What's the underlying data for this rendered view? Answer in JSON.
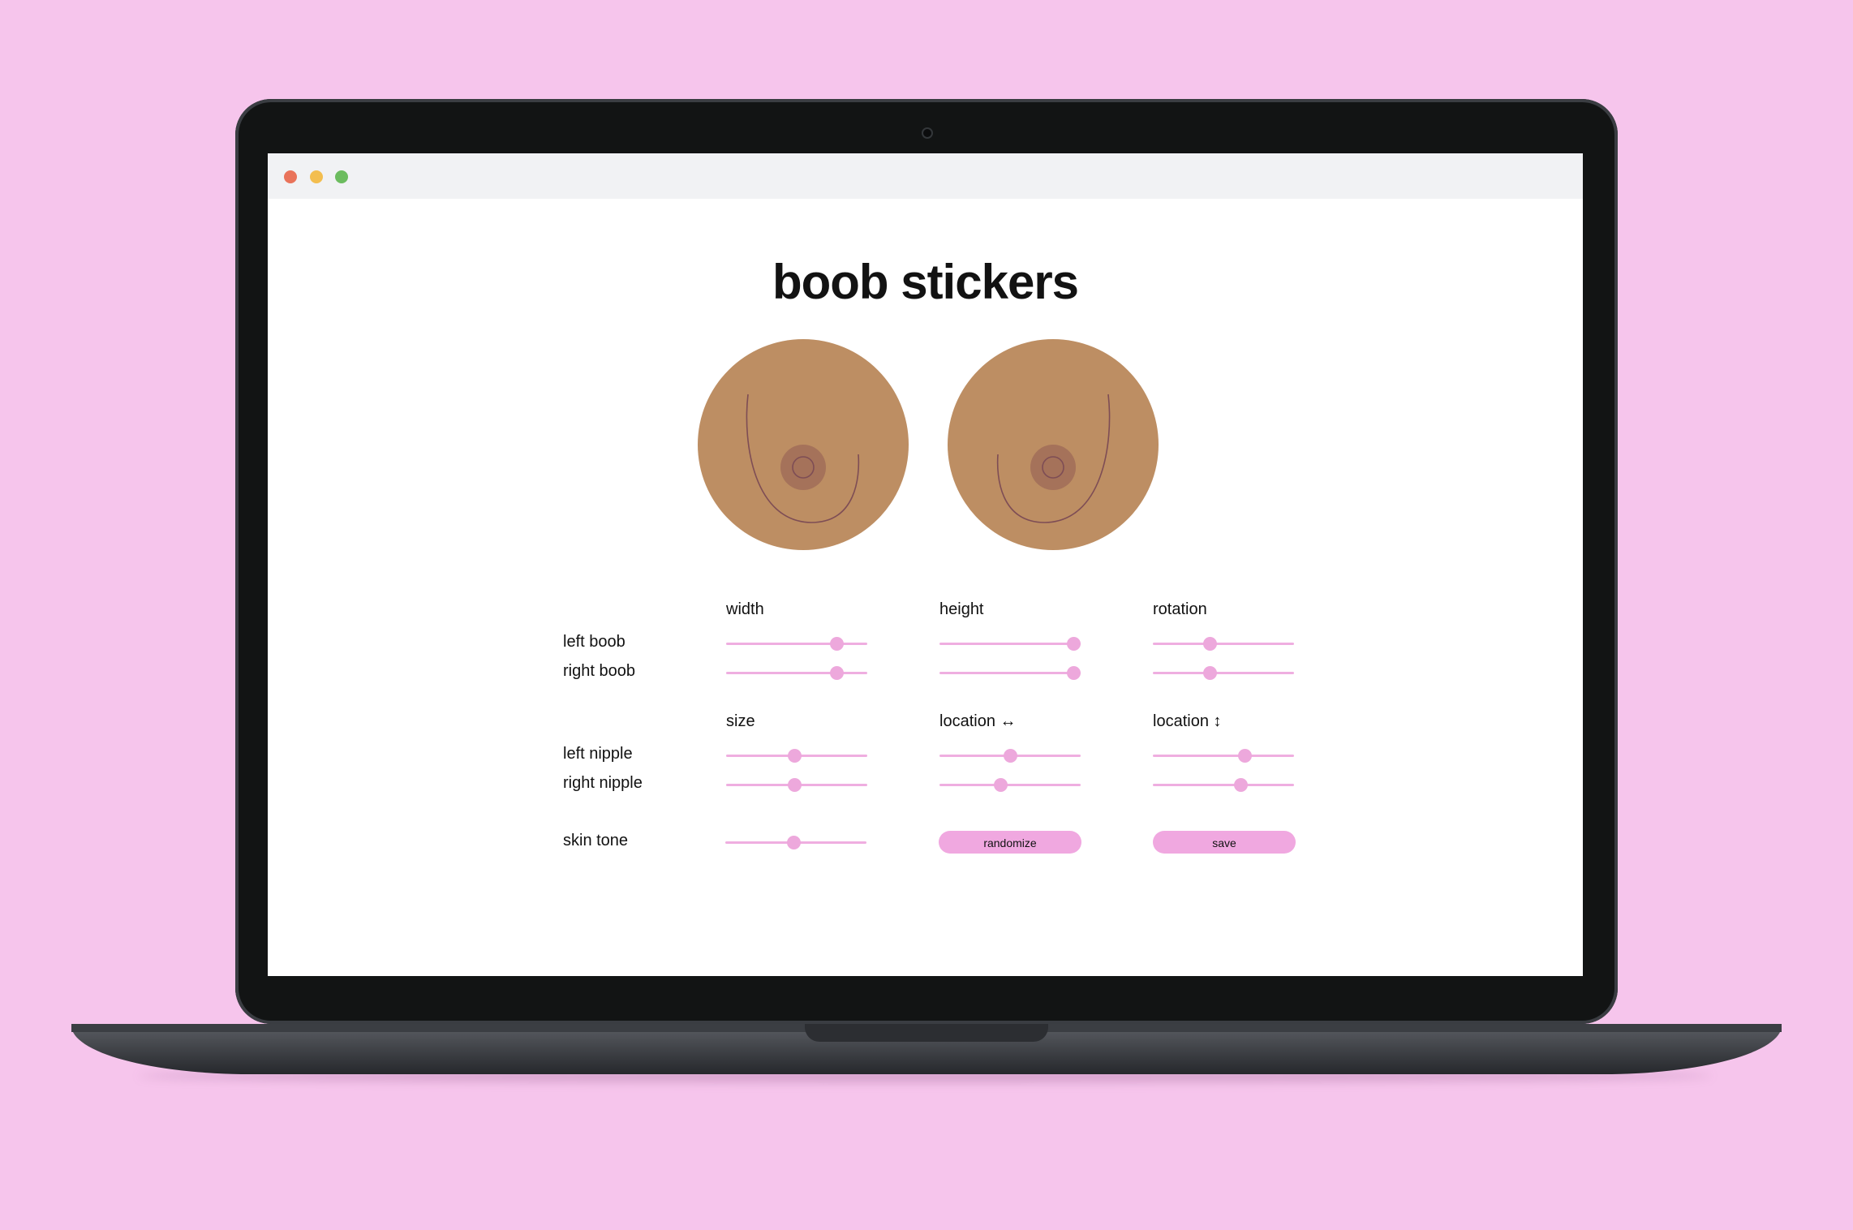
{
  "app": {
    "title": "boob stickers"
  },
  "columns_boob": {
    "c1": "width",
    "c2": "height",
    "c3": "rotation"
  },
  "columns_nipple": {
    "c1": "size",
    "c2": "location ↔",
    "c3": "location ↕"
  },
  "rows": {
    "left_boob": "left boob",
    "right_boob": "right boob",
    "left_nipple": "left nipple",
    "right_nipple": "right nipple",
    "skin_tone": "skin tone"
  },
  "slider_values": {
    "left_boob": {
      "width": 0.78,
      "height": 0.95,
      "rotation": 0.4
    },
    "right_boob": {
      "width": 0.78,
      "height": 0.95,
      "rotation": 0.4
    },
    "left_nipple": {
      "size": 0.48,
      "location_h": 0.5,
      "location_v": 0.65
    },
    "right_nipple": {
      "size": 0.48,
      "location_h": 0.43,
      "location_v": 0.62
    },
    "skin_tone": 0.48
  },
  "buttons": {
    "randomize": "randomize",
    "save": "save"
  },
  "colors": {
    "background": "#f6c5ec",
    "skin": "#bd8e63",
    "areola": "#a5725a",
    "line": "#7e4d55",
    "slider_accent": "#eda8dc",
    "button": "#f0a8e0"
  }
}
